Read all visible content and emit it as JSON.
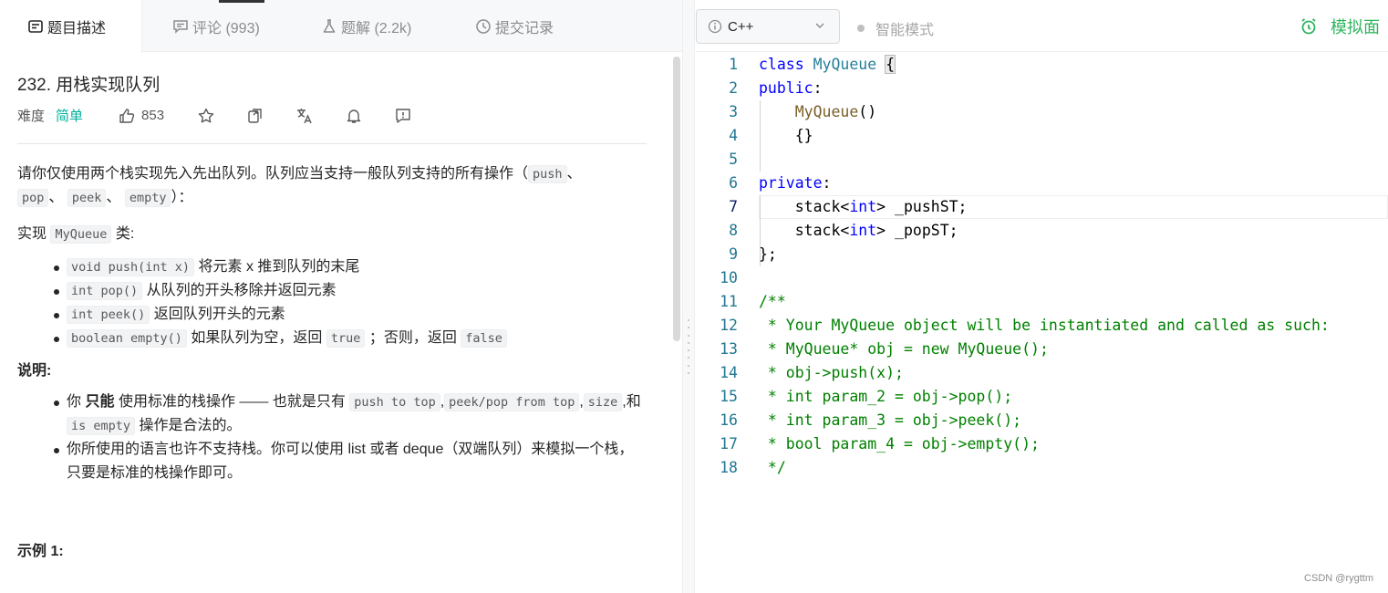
{
  "tabs": [
    {
      "label": "题目描述",
      "icon": "description-icon"
    },
    {
      "label": "评论 (993)",
      "icon": "comment-icon"
    },
    {
      "label": "题解 (2.2k)",
      "icon": "flask-icon"
    },
    {
      "label": "提交记录",
      "icon": "clock-icon"
    }
  ],
  "problem": {
    "title": "232. 用栈实现队列",
    "difficulty_label": "难度",
    "difficulty": "简单",
    "likes": "853"
  },
  "description": {
    "intro_1": "请你仅使用两个栈实现先入先出队列。队列应当支持一般队列支持的所有操作（",
    "op_push": "push",
    "sep_1": "、",
    "op_pop": "pop",
    "sep_2": "、",
    "op_peek": "peek",
    "sep_3": "、",
    "op_empty": "empty",
    "intro_end": "）：",
    "impl_prefix": "实现",
    "impl_class": "MyQueue",
    "impl_suffix": "类:",
    "methods": [
      {
        "code": "void push(int x)",
        "text": "将元素 x 推到队列的末尾"
      },
      {
        "code": "int pop()",
        "text": "从队列的开头移除并返回元素"
      },
      {
        "code": "int peek()",
        "text": "返回队列开头的元素"
      }
    ],
    "empty_code": "boolean empty()",
    "empty_text_1": "如果队列为空，返回",
    "empty_true": "true",
    "empty_text_2": "；否则，返回",
    "empty_false": "false",
    "notes_heading": "说明:",
    "note1_a": "你",
    "note1_bold": "只能",
    "note1_b": "使用标准的栈操作 —— 也就是只有",
    "note1_code1": "push to top",
    "note1_c": ",",
    "note1_code2": "peek/pop from top",
    "note1_d": ",",
    "note1_code3": "size",
    "note1_e": ",和",
    "note1_code4": "is empty",
    "note1_f": "操作是合法的。",
    "note2": "你所使用的语言也许不支持栈。你可以使用 list 或者 deque（双端队列）来模拟一个栈，只要是标准的栈操作即可。",
    "example_heading": "示例 1:"
  },
  "editor": {
    "language": "C++",
    "smart_mode": "智能模式",
    "mock_interview": "模拟面",
    "current_line": 7,
    "lines": [
      "class MyQueue {",
      "public:",
      "    MyQueue()",
      "    {}",
      "",
      "private:",
      "    stack<int> _pushST;",
      "    stack<int> _popST;",
      "};",
      "",
      "/**",
      " * Your MyQueue object will be instantiated and called as such:",
      " * MyQueue* obj = new MyQueue();",
      " * obj->push(x);",
      " * int param_2 = obj->pop();",
      " * int param_3 = obj->peek();",
      " * bool param_4 = obj->empty();",
      " */"
    ]
  },
  "watermark": "CSDN @rygttm"
}
